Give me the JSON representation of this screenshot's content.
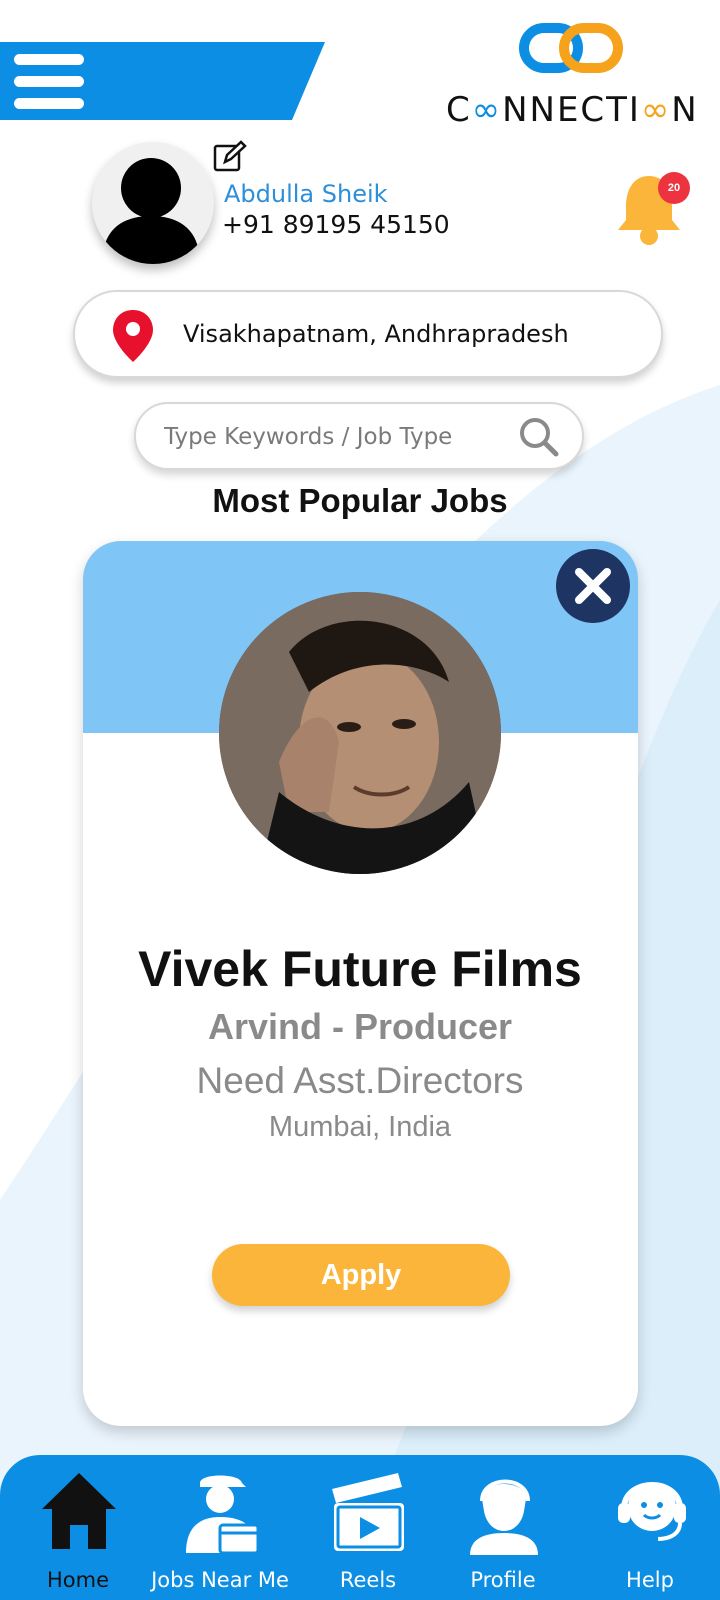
{
  "app": {
    "logo_text": "C N NECTI N",
    "colors": {
      "primary_blue": "#0b8ee4",
      "accent_orange": "#fbb53a",
      "card_top": "#7fc6f7",
      "close_navy": "#1e3563",
      "badge_red": "#ee3340"
    }
  },
  "header": {
    "menu_icon": "hamburger-icon",
    "logo_icon": "chain-link-icon"
  },
  "user": {
    "name": "Abdulla Sheik",
    "phone": "+91 89195 45150",
    "edit_icon": "edit-icon",
    "notifications_count": "20"
  },
  "location": {
    "text": "Visakhapatnam, Andhrapradesh",
    "icon": "map-pin-icon"
  },
  "search": {
    "placeholder": "Type Keywords / Job Type",
    "icon": "search-icon"
  },
  "section": {
    "title": "Most Popular Jobs"
  },
  "job_card": {
    "company": "Vivek Future Films",
    "contact": "Arvind - Producer",
    "need": "Need Asst.Directors",
    "location": "Mumbai, India",
    "apply_label": "Apply",
    "close_icon": "close-icon"
  },
  "bottom_nav": {
    "items": [
      {
        "label": "Home",
        "icon": "home-icon",
        "active": true
      },
      {
        "label": "Jobs Near Me",
        "icon": "director-icon",
        "active": false
      },
      {
        "label": "Reels",
        "icon": "clapperboard-icon",
        "active": false
      },
      {
        "label": "Profile",
        "icon": "profile-icon",
        "active": false
      },
      {
        "label": "Help",
        "icon": "support-icon",
        "active": false
      }
    ]
  }
}
